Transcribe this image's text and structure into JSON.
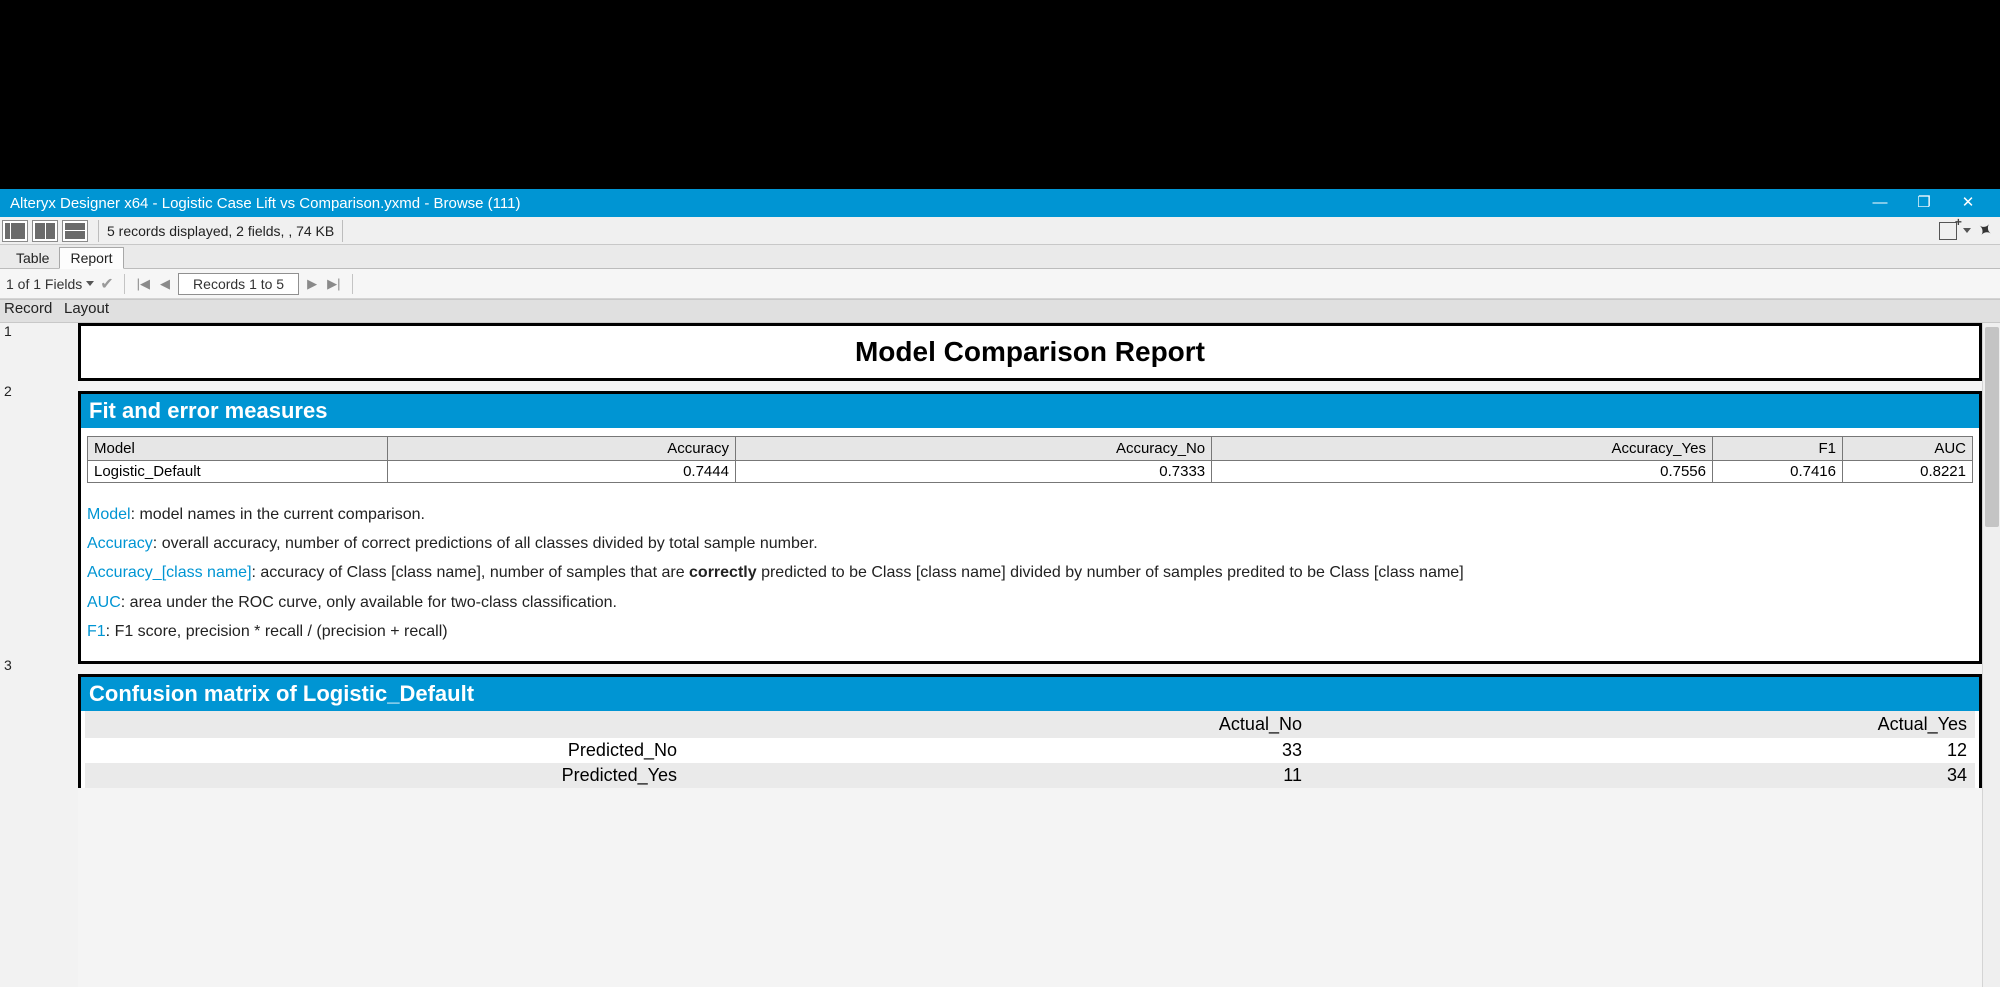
{
  "titlebar": {
    "text": "Alteryx Designer x64 - Logistic Case Lift vs Comparison.yxmd - Browse (111)"
  },
  "toolbar1": {
    "status": "5 records displayed, 2 fields, , 74 KB"
  },
  "tabs": {
    "table": "Table",
    "report": "Report"
  },
  "nav": {
    "fields": "1 of 1 Fields",
    "records": "Records 1 to 5"
  },
  "columns": {
    "record": "Record",
    "layout": "Layout"
  },
  "rows": {
    "r1": "1",
    "r2": "2",
    "r3": "3"
  },
  "report": {
    "title": "Model Comparison Report",
    "section_fit": "Fit and error measures",
    "metrics": {
      "headers": {
        "model": "Model",
        "accuracy": "Accuracy",
        "acc_no": "Accuracy_No",
        "acc_yes": "Accuracy_Yes",
        "f1": "F1",
        "auc": "AUC"
      },
      "row": {
        "model": "Logistic_Default",
        "accuracy": "0.7444",
        "acc_no": "0.7333",
        "acc_yes": "0.7556",
        "f1": "0.7416",
        "auc": "0.8221"
      }
    },
    "defs": {
      "model_k": "Model",
      "model_v": ": model names in the current comparison.",
      "acc_k": "Accuracy",
      "acc_v": ": overall accuracy, number of correct predictions of all classes divided by total sample number.",
      "accc_k": "Accuracy_[class name]",
      "accc_v1": ": accuracy of Class [class name], number of samples that are ",
      "accc_b": "correctly",
      "accc_v2": " predicted to be Class [class name] divided by number of samples predited to be Class [class name]",
      "auc_k": "AUC",
      "auc_v": ": area under the ROC curve, only available for two-class classification.",
      "f1_k": "F1",
      "f1_v": ": F1 score, precision * recall / (precision + recall)"
    },
    "section_conf": "Confusion matrix of Logistic_Default",
    "conf": {
      "h_no": "Actual_No",
      "h_yes": "Actual_Yes",
      "r1": "Predicted_No",
      "r1_no": "33",
      "r1_yes": "12",
      "r2": "Predicted_Yes",
      "r2_no": "11",
      "r2_yes": "34"
    }
  },
  "chart_data": [
    {
      "type": "table",
      "title": "Fit and error measures",
      "columns": [
        "Model",
        "Accuracy",
        "Accuracy_No",
        "Accuracy_Yes",
        "F1",
        "AUC"
      ],
      "rows": [
        [
          "Logistic_Default",
          0.7444,
          0.7333,
          0.7556,
          0.7416,
          0.8221
        ]
      ]
    },
    {
      "type": "table",
      "title": "Confusion matrix of Logistic_Default",
      "columns": [
        "",
        "Actual_No",
        "Actual_Yes"
      ],
      "rows": [
        [
          "Predicted_No",
          33,
          12
        ],
        [
          "Predicted_Yes",
          11,
          34
        ]
      ]
    }
  ]
}
